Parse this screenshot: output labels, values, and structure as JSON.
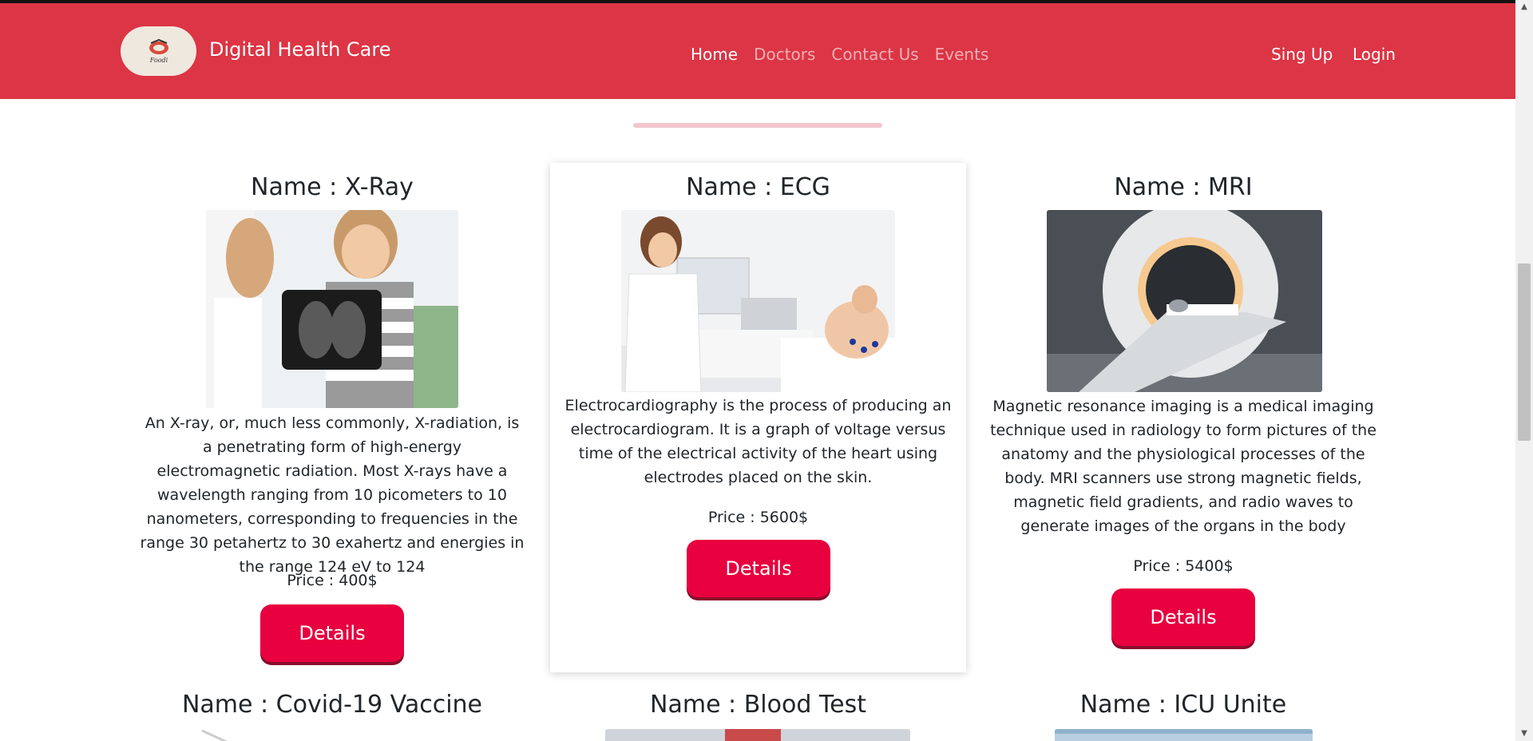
{
  "header": {
    "brand_title": "Digital Health Care",
    "logo_text": "Foodi",
    "nav": [
      {
        "label": "Home",
        "active": true
      },
      {
        "label": "Doctors",
        "active": false
      },
      {
        "label": "Contact Us",
        "active": false
      },
      {
        "label": "Events",
        "active": false
      }
    ],
    "signup_label": "Sing Up",
    "login_label": "Login"
  },
  "colors": {
    "navbar": "#dc3545",
    "button": "#e8003f"
  },
  "services": [
    {
      "title": "Name : X-Ray",
      "description": "An X-ray, or, much less commonly, X-radiation, is a penetrating form of high-energy electromagnetic radiation. Most X-rays have a wavelength ranging from 10 picometers to 10 nanometers, corresponding to frequencies in the range 30 petahertz to 30 exahertz and energies in the range 124 eV to 124",
      "price": "Price : 400$",
      "button": "Details"
    },
    {
      "title": "Name : ECG",
      "description": "Electrocardiography is the process of producing an electrocardiogram. It is a graph of voltage versus time of the electrical activity of the heart using electrodes placed on the skin.",
      "price": "Price : 5600$",
      "button": "Details"
    },
    {
      "title": "Name : MRI",
      "description": "Magnetic resonance imaging is a medical imaging technique used in radiology to form pictures of the anatomy and the physiological processes of the body. MRI scanners use strong magnetic fields, magnetic field gradients, and radio waves to generate images of the organs in the body",
      "price": "Price : 5400$",
      "button": "Details"
    },
    {
      "title": "Name : Covid-19 Vaccine"
    },
    {
      "title": "Name : Blood Test"
    },
    {
      "title": "Name : ICU Unite"
    }
  ]
}
